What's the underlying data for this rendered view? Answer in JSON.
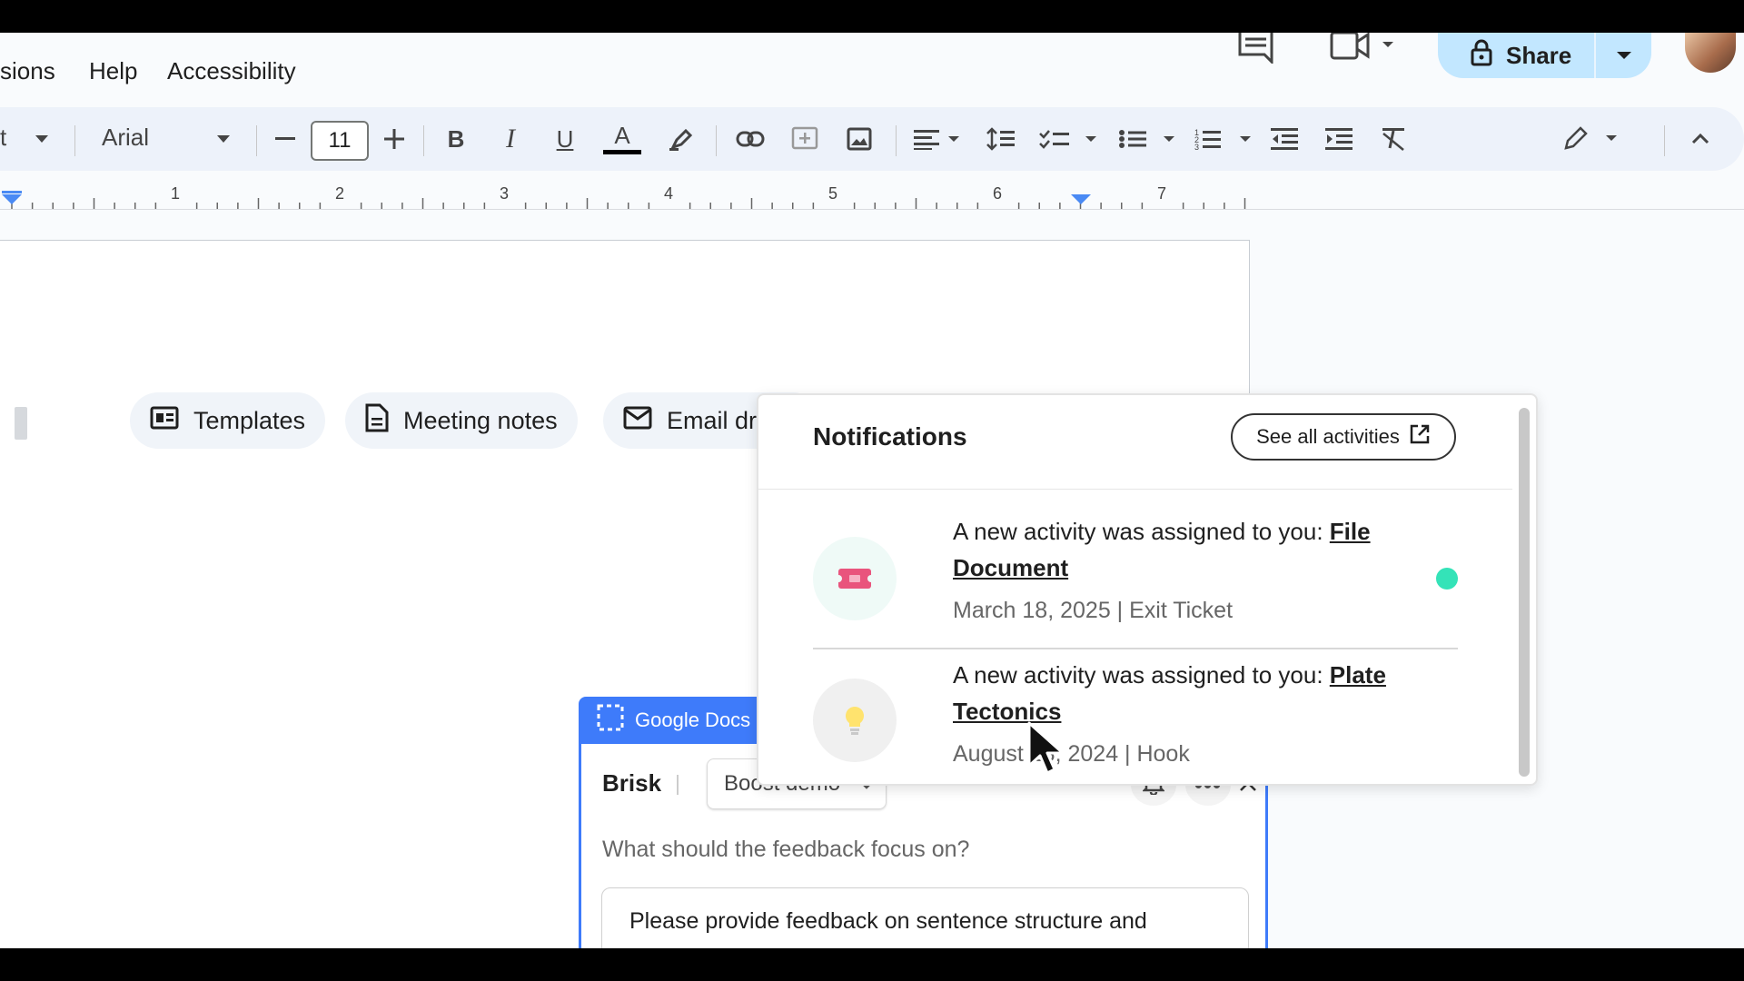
{
  "menu": {
    "items": [
      "sions",
      "Help",
      "Accessibility"
    ]
  },
  "header": {
    "share_label": "Share"
  },
  "toolbar": {
    "style_fragment": "t",
    "font_name": "Arial",
    "font_size": "11"
  },
  "ruler": {
    "numbers": [
      "1",
      "2",
      "3",
      "4",
      "5",
      "6",
      "7"
    ]
  },
  "chips": [
    {
      "label": "Templates",
      "icon": "template-icon"
    },
    {
      "label": "Meeting notes",
      "icon": "document-icon"
    },
    {
      "label": "Email dr",
      "icon": "email-icon"
    }
  ],
  "notifications": {
    "title": "Notifications",
    "see_all_label": "See all activities",
    "items": [
      {
        "prefix": "A new activity was assigned to you: ",
        "link_line1": "File",
        "link_line2": "Document",
        "meta": "March 18, 2025 | Exit Ticket",
        "icon": "ticket-icon",
        "unread": true
      },
      {
        "prefix": "A new activity was assigned to you: ",
        "link_line1": "Plate",
        "link_line2": "Tectonics",
        "meta": "August 23, 2024 | Hook",
        "icon": "lightbulb-icon",
        "unread": false
      }
    ]
  },
  "brisk": {
    "tab_label": "Google Docs",
    "logo": "Brisk",
    "dropdown_value": "Boost demo",
    "question": "What should the feedback focus on?",
    "feedback_text": "Please provide feedback on sentence structure and"
  },
  "colors": {
    "accent_blue": "#3e7bfa",
    "share_bg": "#c2e7ff",
    "mint": "#34e3b8",
    "toolbar_bg": "#edf2fa"
  }
}
